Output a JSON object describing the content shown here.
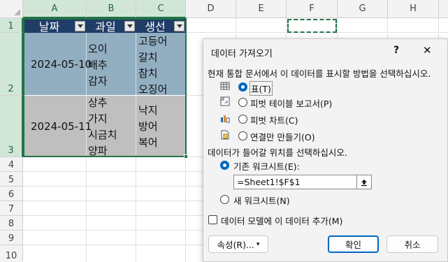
{
  "columns": [
    "A",
    "B",
    "C",
    "D",
    "E",
    "F",
    "G",
    "H"
  ],
  "rows": [
    "1",
    "2",
    "3",
    "4",
    "5",
    "6",
    "7",
    "8",
    "9",
    "10"
  ],
  "table": {
    "headers": [
      "날짜",
      "과일",
      "생선"
    ],
    "rows": [
      {
        "date": "2024-05-10",
        "fruits": [
          "오이",
          "배추",
          "감자"
        ],
        "fish": [
          "고등어",
          "갈치",
          "참치",
          "오징어"
        ]
      },
      {
        "date": "2024-05-11",
        "fruits": [
          "상추",
          "가지",
          "시금치",
          "양파"
        ],
        "fish": [
          "낙지",
          "방어",
          "복어"
        ]
      }
    ]
  },
  "dialog": {
    "title": "데이터 가져오기",
    "help": "?",
    "close": "✕",
    "prompt_view": "현재 통합 문서에서 이 데이터를 표시할 방법을 선택하십시오.",
    "options": [
      {
        "label": "표(T)",
        "selected": true
      },
      {
        "label": "피벗 테이블 보고서(P)",
        "selected": false
      },
      {
        "label": "피벗 차트(C)",
        "selected": false
      },
      {
        "label": "연결만 만들기(O)",
        "selected": false
      }
    ],
    "prompt_location": "데이터가 들어갈 위치를 선택하십시오.",
    "existing_sheet": "기존 워크시트(E):",
    "location_value": "=Sheet1!$F$1",
    "new_sheet": "새 워크시트(N)",
    "add_model": "데이터 모델에 이 데이터 추가(M)",
    "properties": "속성(R)...",
    "ok": "확인",
    "cancel": "취소"
  },
  "colors": {
    "header": "#1f3d66",
    "row_blue": "#92afc2",
    "row_gray": "#bfbfbf",
    "accent": "#217346",
    "radio": "#0067c0"
  }
}
